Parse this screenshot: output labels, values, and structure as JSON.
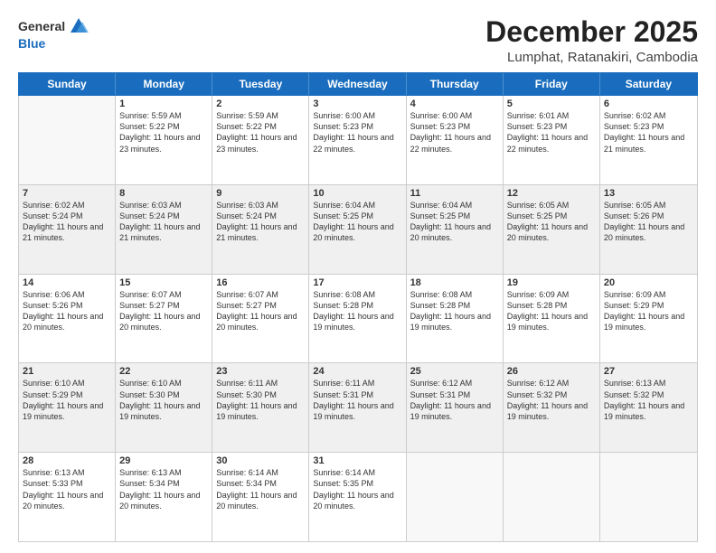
{
  "header": {
    "logo_line1": "General",
    "logo_line2": "Blue",
    "main_title": "December 2025",
    "subtitle": "Lumphat, Ratanakiri, Cambodia"
  },
  "days_of_week": [
    "Sunday",
    "Monday",
    "Tuesday",
    "Wednesday",
    "Thursday",
    "Friday",
    "Saturday"
  ],
  "weeks": [
    {
      "alt": false,
      "cells": [
        {
          "empty": true
        },
        {
          "day": "1",
          "sunrise": "Sunrise: 5:59 AM",
          "sunset": "Sunset: 5:22 PM",
          "daylight": "Daylight: 11 hours and 23 minutes."
        },
        {
          "day": "2",
          "sunrise": "Sunrise: 5:59 AM",
          "sunset": "Sunset: 5:22 PM",
          "daylight": "Daylight: 11 hours and 23 minutes."
        },
        {
          "day": "3",
          "sunrise": "Sunrise: 6:00 AM",
          "sunset": "Sunset: 5:23 PM",
          "daylight": "Daylight: 11 hours and 22 minutes."
        },
        {
          "day": "4",
          "sunrise": "Sunrise: 6:00 AM",
          "sunset": "Sunset: 5:23 PM",
          "daylight": "Daylight: 11 hours and 22 minutes."
        },
        {
          "day": "5",
          "sunrise": "Sunrise: 6:01 AM",
          "sunset": "Sunset: 5:23 PM",
          "daylight": "Daylight: 11 hours and 22 minutes."
        },
        {
          "day": "6",
          "sunrise": "Sunrise: 6:02 AM",
          "sunset": "Sunset: 5:23 PM",
          "daylight": "Daylight: 11 hours and 21 minutes."
        }
      ]
    },
    {
      "alt": true,
      "cells": [
        {
          "day": "7",
          "sunrise": "Sunrise: 6:02 AM",
          "sunset": "Sunset: 5:24 PM",
          "daylight": "Daylight: 11 hours and 21 minutes."
        },
        {
          "day": "8",
          "sunrise": "Sunrise: 6:03 AM",
          "sunset": "Sunset: 5:24 PM",
          "daylight": "Daylight: 11 hours and 21 minutes."
        },
        {
          "day": "9",
          "sunrise": "Sunrise: 6:03 AM",
          "sunset": "Sunset: 5:24 PM",
          "daylight": "Daylight: 11 hours and 21 minutes."
        },
        {
          "day": "10",
          "sunrise": "Sunrise: 6:04 AM",
          "sunset": "Sunset: 5:25 PM",
          "daylight": "Daylight: 11 hours and 20 minutes."
        },
        {
          "day": "11",
          "sunrise": "Sunrise: 6:04 AM",
          "sunset": "Sunset: 5:25 PM",
          "daylight": "Daylight: 11 hours and 20 minutes."
        },
        {
          "day": "12",
          "sunrise": "Sunrise: 6:05 AM",
          "sunset": "Sunset: 5:25 PM",
          "daylight": "Daylight: 11 hours and 20 minutes."
        },
        {
          "day": "13",
          "sunrise": "Sunrise: 6:05 AM",
          "sunset": "Sunset: 5:26 PM",
          "daylight": "Daylight: 11 hours and 20 minutes."
        }
      ]
    },
    {
      "alt": false,
      "cells": [
        {
          "day": "14",
          "sunrise": "Sunrise: 6:06 AM",
          "sunset": "Sunset: 5:26 PM",
          "daylight": "Daylight: 11 hours and 20 minutes."
        },
        {
          "day": "15",
          "sunrise": "Sunrise: 6:07 AM",
          "sunset": "Sunset: 5:27 PM",
          "daylight": "Daylight: 11 hours and 20 minutes."
        },
        {
          "day": "16",
          "sunrise": "Sunrise: 6:07 AM",
          "sunset": "Sunset: 5:27 PM",
          "daylight": "Daylight: 11 hours and 20 minutes."
        },
        {
          "day": "17",
          "sunrise": "Sunrise: 6:08 AM",
          "sunset": "Sunset: 5:28 PM",
          "daylight": "Daylight: 11 hours and 19 minutes."
        },
        {
          "day": "18",
          "sunrise": "Sunrise: 6:08 AM",
          "sunset": "Sunset: 5:28 PM",
          "daylight": "Daylight: 11 hours and 19 minutes."
        },
        {
          "day": "19",
          "sunrise": "Sunrise: 6:09 AM",
          "sunset": "Sunset: 5:28 PM",
          "daylight": "Daylight: 11 hours and 19 minutes."
        },
        {
          "day": "20",
          "sunrise": "Sunrise: 6:09 AM",
          "sunset": "Sunset: 5:29 PM",
          "daylight": "Daylight: 11 hours and 19 minutes."
        }
      ]
    },
    {
      "alt": true,
      "cells": [
        {
          "day": "21",
          "sunrise": "Sunrise: 6:10 AM",
          "sunset": "Sunset: 5:29 PM",
          "daylight": "Daylight: 11 hours and 19 minutes."
        },
        {
          "day": "22",
          "sunrise": "Sunrise: 6:10 AM",
          "sunset": "Sunset: 5:30 PM",
          "daylight": "Daylight: 11 hours and 19 minutes."
        },
        {
          "day": "23",
          "sunrise": "Sunrise: 6:11 AM",
          "sunset": "Sunset: 5:30 PM",
          "daylight": "Daylight: 11 hours and 19 minutes."
        },
        {
          "day": "24",
          "sunrise": "Sunrise: 6:11 AM",
          "sunset": "Sunset: 5:31 PM",
          "daylight": "Daylight: 11 hours and 19 minutes."
        },
        {
          "day": "25",
          "sunrise": "Sunrise: 6:12 AM",
          "sunset": "Sunset: 5:31 PM",
          "daylight": "Daylight: 11 hours and 19 minutes."
        },
        {
          "day": "26",
          "sunrise": "Sunrise: 6:12 AM",
          "sunset": "Sunset: 5:32 PM",
          "daylight": "Daylight: 11 hours and 19 minutes."
        },
        {
          "day": "27",
          "sunrise": "Sunrise: 6:13 AM",
          "sunset": "Sunset: 5:32 PM",
          "daylight": "Daylight: 11 hours and 19 minutes."
        }
      ]
    },
    {
      "alt": false,
      "cells": [
        {
          "day": "28",
          "sunrise": "Sunrise: 6:13 AM",
          "sunset": "Sunset: 5:33 PM",
          "daylight": "Daylight: 11 hours and 20 minutes."
        },
        {
          "day": "29",
          "sunrise": "Sunrise: 6:13 AM",
          "sunset": "Sunset: 5:34 PM",
          "daylight": "Daylight: 11 hours and 20 minutes."
        },
        {
          "day": "30",
          "sunrise": "Sunrise: 6:14 AM",
          "sunset": "Sunset: 5:34 PM",
          "daylight": "Daylight: 11 hours and 20 minutes."
        },
        {
          "day": "31",
          "sunrise": "Sunrise: 6:14 AM",
          "sunset": "Sunset: 5:35 PM",
          "daylight": "Daylight: 11 hours and 20 minutes."
        },
        {
          "empty": true
        },
        {
          "empty": true
        },
        {
          "empty": true
        }
      ]
    }
  ]
}
